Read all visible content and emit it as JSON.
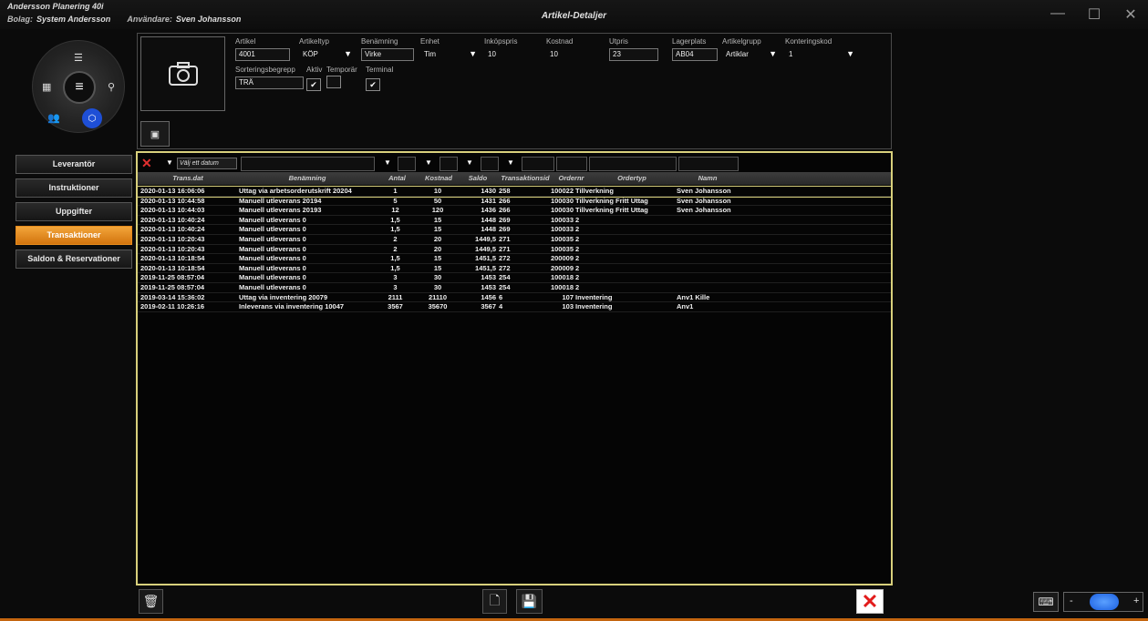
{
  "app": {
    "title": "Andersson Planering 40i",
    "bolag_label": "Bolag:",
    "bolag_value": "System Andersson",
    "user_label": "Användare:",
    "user_value": "Sven Johansson",
    "window_title": "Artikel-Detaljer"
  },
  "sidebar": {
    "items": [
      {
        "label": "Leverantör"
      },
      {
        "label": "Instruktioner"
      },
      {
        "label": "Uppgifter"
      },
      {
        "label": "Transaktioner"
      },
      {
        "label": "Saldon & Reservationer"
      }
    ],
    "active": "Transaktioner"
  },
  "form": {
    "artikel": {
      "label": "Artikel",
      "value": "4001"
    },
    "artikeltyp": {
      "label": "Artikeltyp",
      "value": "KÖP"
    },
    "benamning": {
      "label": "Benämning",
      "value": "Virke"
    },
    "enhet": {
      "label": "Enhet",
      "value": "Tim"
    },
    "inkopspris": {
      "label": "Inköpspris",
      "value": "10"
    },
    "kostnad": {
      "label": "Kostnad",
      "value": "10"
    },
    "utpris": {
      "label": "Utpris",
      "value": "23"
    },
    "lagerplats": {
      "label": "Lagerplats",
      "value": "AB04"
    },
    "artikelgrupp": {
      "label": "Artikelgrupp",
      "value": "Artiklar"
    },
    "konteringskod": {
      "label": "Konteringskod",
      "value": "1"
    },
    "sorteringsbegrepp": {
      "label": "Sorteringsbegrepp",
      "value": "TRÄ"
    },
    "aktiv": {
      "label": "Aktiv",
      "checked": true
    },
    "temporar": {
      "label": "Temporär",
      "checked": false
    },
    "terminal": {
      "label": "Terminal",
      "checked": true
    }
  },
  "grid": {
    "date_filter_placeholder": "Välj ett datum",
    "headers": {
      "date": "Trans.dat",
      "benamning": "Benämning",
      "antal": "Antal",
      "kostnad": "Kostnad",
      "saldo": "Saldo",
      "trans": "Transaktionsid",
      "ordernr": "Ordernr",
      "ordertyp": "Ordertyp",
      "namn": "Namn"
    },
    "rows": [
      {
        "date": "2020-01-13 16:06:06",
        "ben": "Uttag via arbetsorderutskrift 20204",
        "antal": "1",
        "kost": "10",
        "saldo": "1430",
        "trans": "258",
        "ordernr": "100022",
        "ordertyp": "Tillverkning",
        "namn": "Sven Johansson"
      },
      {
        "date": "2020-01-13 10:44:58",
        "ben": "Manuell utleverans 20194",
        "antal": "5",
        "kost": "50",
        "saldo": "1431",
        "trans": "266",
        "ordernr": "100030",
        "ordertyp": "Tillverkning Fritt Uttag",
        "namn": "Sven Johansson"
      },
      {
        "date": "2020-01-13 10:44:03",
        "ben": "Manuell utleverans 20193",
        "antal": "12",
        "kost": "120",
        "saldo": "1436",
        "trans": "266",
        "ordernr": "100030",
        "ordertyp": "Tillverkning Fritt Uttag",
        "namn": "Sven Johansson"
      },
      {
        "date": "2020-01-13 10:40:24",
        "ben": "Manuell utleverans 0",
        "antal": "1,5",
        "kost": "15",
        "saldo": "1448",
        "trans": "269",
        "ordernr": "100033",
        "ordertyp": "2",
        "namn": ""
      },
      {
        "date": "2020-01-13 10:40:24",
        "ben": "Manuell utleverans 0",
        "antal": "1,5",
        "kost": "15",
        "saldo": "1448",
        "trans": "269",
        "ordernr": "100033",
        "ordertyp": "2",
        "namn": ""
      },
      {
        "date": "2020-01-13 10:20:43",
        "ben": "Manuell utleverans 0",
        "antal": "2",
        "kost": "20",
        "saldo": "1449,5",
        "trans": "271",
        "ordernr": "100035",
        "ordertyp": "2",
        "namn": ""
      },
      {
        "date": "2020-01-13 10:20:43",
        "ben": "Manuell utleverans 0",
        "antal": "2",
        "kost": "20",
        "saldo": "1449,5",
        "trans": "271",
        "ordernr": "100035",
        "ordertyp": "2",
        "namn": ""
      },
      {
        "date": "2020-01-13 10:18:54",
        "ben": "Manuell utleverans 0",
        "antal": "1,5",
        "kost": "15",
        "saldo": "1451,5",
        "trans": "272",
        "ordernr": "200009",
        "ordertyp": "2",
        "namn": ""
      },
      {
        "date": "2020-01-13 10:18:54",
        "ben": "Manuell utleverans 0",
        "antal": "1,5",
        "kost": "15",
        "saldo": "1451,5",
        "trans": "272",
        "ordernr": "200009",
        "ordertyp": "2",
        "namn": ""
      },
      {
        "date": "2019-11-25 08:57:04",
        "ben": "Manuell utleverans 0",
        "antal": "3",
        "kost": "30",
        "saldo": "1453",
        "trans": "254",
        "ordernr": "100018",
        "ordertyp": "2",
        "namn": ""
      },
      {
        "date": "2019-11-25 08:57:04",
        "ben": "Manuell utleverans 0",
        "antal": "3",
        "kost": "30",
        "saldo": "1453",
        "trans": "254",
        "ordernr": "100018",
        "ordertyp": "2",
        "namn": ""
      },
      {
        "date": "2019-03-14 15:36:02",
        "ben": "Uttag via inventering 20079",
        "antal": "2111",
        "kost": "21110",
        "saldo": "1456",
        "trans": "6",
        "ordernr": "107",
        "ordertyp": "Inventering",
        "namn": "Anv1 Kille"
      },
      {
        "date": "2019-02-11 10:26:16",
        "ben": "Inleverans via inventering 10047",
        "antal": "3567",
        "kost": "35670",
        "saldo": "3567",
        "trans": "4",
        "ordernr": "103",
        "ordertyp": "Inventering",
        "namn": "Anv1"
      }
    ]
  },
  "zoom": {
    "minus": "-",
    "plus": "+"
  },
  "colors": {
    "accent_orange": "#e58a1c",
    "grid_border": "#d8d07c",
    "delete_red": "#e21b1b",
    "zoom_blue": "#1b5fe0"
  }
}
